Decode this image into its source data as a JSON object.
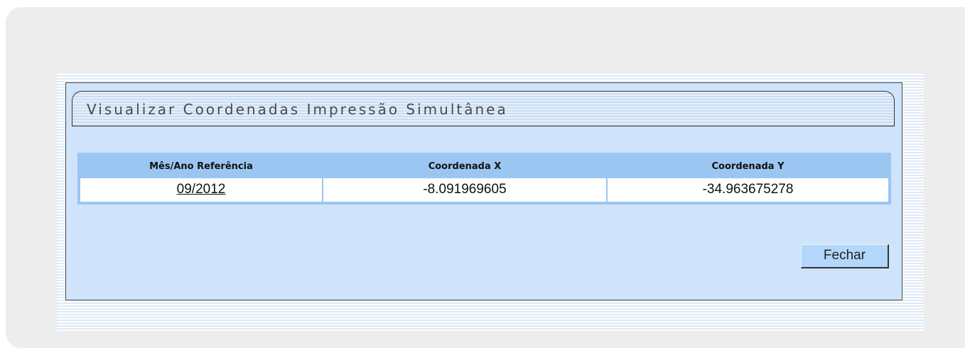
{
  "window": {
    "title": "Visualizar Coordenadas Impressão Simultânea"
  },
  "table": {
    "headers": [
      "Mês/Ano Referência",
      "Coordenada X",
      "Coordenada Y"
    ],
    "rows": [
      [
        "09/2012",
        "-8.091969605",
        "-34.963675278"
      ]
    ]
  },
  "actions": {
    "close_label": "Fechar"
  },
  "colors": {
    "panel_background": "#cfe3fa",
    "header_background": "#9cc6f2",
    "button_background": "#b3d6fb"
  }
}
